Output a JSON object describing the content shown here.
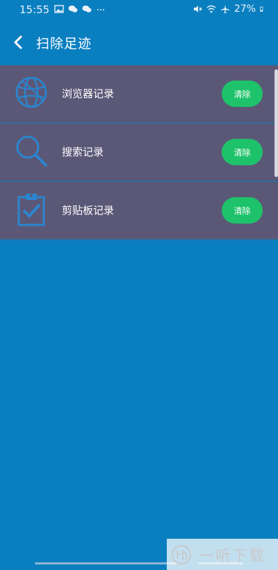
{
  "status_bar": {
    "time": "15:55",
    "battery": "27%",
    "icons_left": [
      "image-icon",
      "wechat-icon",
      "wechat-icon",
      "more-dots-icon"
    ],
    "icons_right": [
      "mute-icon",
      "wifi-icon",
      "airplane-icon",
      "battery-icon"
    ]
  },
  "app_bar": {
    "title": "扫除足迹",
    "back_icon": "back-chevron-icon"
  },
  "items": [
    {
      "icon": "globe-icon",
      "label": "浏览器记录",
      "button": "清除"
    },
    {
      "icon": "search-icon",
      "label": "搜索记录",
      "button": "清除"
    },
    {
      "icon": "clipboard-check-icon",
      "label": "剪贴板记录",
      "button": "清除"
    }
  ],
  "watermark": {
    "text": "一听下载"
  },
  "colors": {
    "background": "#0a7fc0",
    "row": "#5b5877",
    "accent": "#1ec26a",
    "icon": "#2a86d0"
  }
}
